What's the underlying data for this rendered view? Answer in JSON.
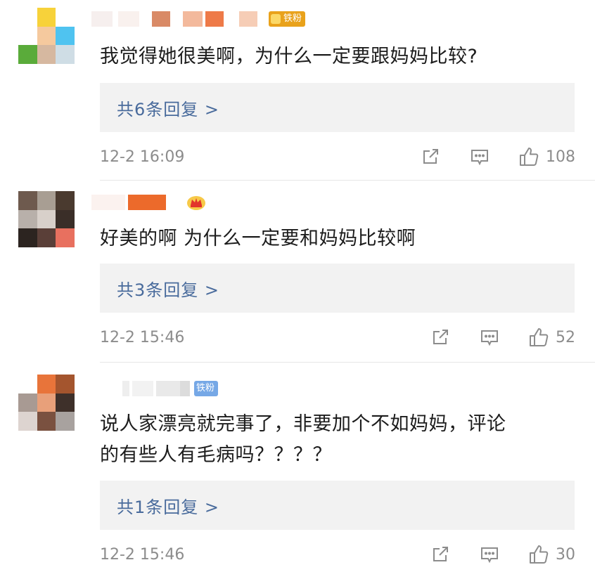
{
  "comments": [
    {
      "badge_label": "铁粉",
      "text": "我觉得她很美啊，为什么一定要跟妈妈比较?",
      "replies_label": "共6条回复 >",
      "time": "12-2 16:09",
      "likes": "108"
    },
    {
      "text": "好美的啊 为什么一定要和妈妈比较啊",
      "replies_label": "共3条回复 >",
      "time": "12-2 15:46",
      "likes": "52"
    },
    {
      "badge_label": "铁粉",
      "text_line1": "说人家漂亮就完事了，非要加个不如妈妈，评论",
      "text_line2": "的有些人有毛病吗？？？？",
      "replies_label": "共1条回复 >",
      "time": "12-2 15:46",
      "likes": "30"
    }
  ],
  "icons": {
    "share": "share-icon",
    "comment": "comment-icon",
    "like": "thumbs-up-icon",
    "crown": "crown-icon"
  },
  "colors": {
    "reply_link": "#496b9c",
    "meta_text": "#8c8c8c",
    "reply_bg": "#f2f2f2",
    "badge_gold": "#e9a21b",
    "badge_blue": "#76a8e6"
  }
}
